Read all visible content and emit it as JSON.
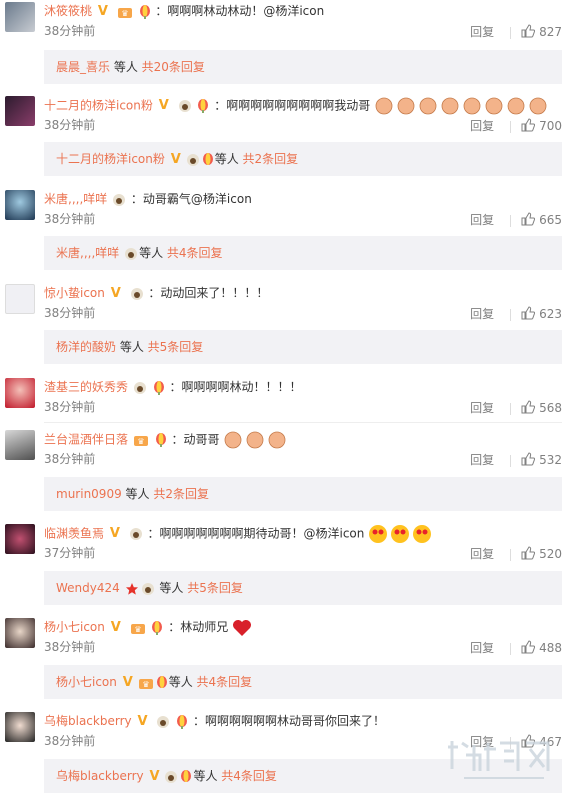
{
  "comments": [
    {
      "user": "沐筱筱桃",
      "text": "：啊啊啊林动林动！@杨洋icon",
      "time": "38分钟前",
      "reply": "回复",
      "likes": "827",
      "replies": {
        "name": "晨晨_喜乐",
        "mid": " 等人 ",
        "total": "共20条回复"
      }
    },
    {
      "user": "十二月的杨洋icon粉",
      "text": "：啊啊啊啊啊啊啊啊啊我动哥",
      "time": "38分钟前",
      "reply": "回复",
      "likes": "700",
      "replies": {
        "name": "十二月的杨洋icon粉",
        "mid": "等人 ",
        "total": "共2条回复"
      }
    },
    {
      "user": "米唐,,,,咩咩",
      "text": "：动哥霸气@杨洋icon",
      "time": "38分钟前",
      "reply": "回复",
      "likes": "665",
      "replies": {
        "name": "米唐,,,,咩咩",
        "mid": "等人 ",
        "total": "共4条回复"
      }
    },
    {
      "user": "惊小蛰icon",
      "text": "：动动回来了！！！！",
      "time": "38分钟前",
      "reply": "回复",
      "likes": "623",
      "replies": {
        "name": "杨洋的酸奶",
        "mid": " 等人 ",
        "total": "共5条回复"
      }
    },
    {
      "user": "渣基三的妖秀秀",
      "text": "：啊啊啊啊林动！！！！",
      "time": "38分钟前",
      "reply": "回复",
      "likes": "568"
    },
    {
      "user": "兰台温酒伴日落",
      "text": "：动哥哥",
      "time": "38分钟前",
      "reply": "回复",
      "likes": "532",
      "replies": {
        "name": "murin0909",
        "mid": " 等人 ",
        "total": "共2条回复"
      }
    },
    {
      "user": "临渊羡鱼焉",
      "text": "：啊啊啊啊啊啊啊期待动哥！@杨洋icon",
      "time": "37分钟前",
      "reply": "回复",
      "likes": "520",
      "replies": {
        "name": "Wendy424",
        "mid": " 等人 ",
        "total": "共5条回复"
      }
    },
    {
      "user": "杨小七icon",
      "text": "：林动师兄",
      "time": "38分钟前",
      "reply": "回复",
      "likes": "488",
      "replies": {
        "name": "杨小七icon",
        "mid": "等人 ",
        "total": "共4条回复"
      }
    },
    {
      "user": "乌梅blackberry",
      "text": "：啊啊啊啊啊啊林动哥哥你回来了！",
      "time": "38分钟前",
      "reply": "回复",
      "likes": "467",
      "replies": {
        "name": "乌梅blackberry",
        "mid": "等人 ",
        "total": "共4条回复"
      }
    }
  ],
  "colors": {
    "username": "#eb7350",
    "meta": "#808080",
    "reply_bg": "#f2f2f5"
  }
}
